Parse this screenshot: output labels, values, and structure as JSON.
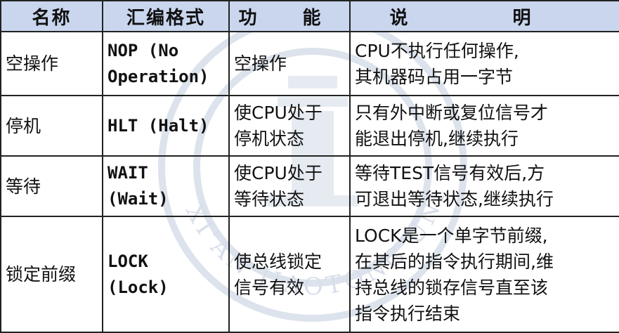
{
  "table": {
    "headers": [
      "名称",
      "汇编格式",
      "功 能",
      "说 明"
    ],
    "rows": [
      {
        "name": "空操作",
        "format_lines": [
          "NOP (No",
          "Operation)"
        ],
        "function_lines": [
          "空操作"
        ],
        "description_lines": [
          "CPU不执行任何操作,",
          "其机器码占用一字节"
        ]
      },
      {
        "name": "停机",
        "format_lines": [
          "HLT (Halt)"
        ],
        "function_lines": [
          "使CPU处于",
          "停机状态"
        ],
        "description_lines": [
          "只有外中断或复位信号才",
          "能退出停机,继续执行"
        ]
      },
      {
        "name": "等待",
        "format_lines": [
          "WAIT",
          "(Wait)"
        ],
        "function_lines": [
          "使CPU处于",
          "等待状态"
        ],
        "description_lines": [
          "等待TEST信号有效后,方",
          "可退出等待状态,继续执行"
        ]
      },
      {
        "name": "锁定前缀",
        "format_lines": [
          "LOCK",
          "(Lock)"
        ],
        "function_lines": [
          "使总线锁定",
          "信号有效"
        ],
        "description_lines": [
          "LOCK是一个单字节前缀,",
          "在其后的指令执行期间,维",
          "持总线的锁存信号直至该",
          "指令执行结束"
        ]
      }
    ]
  },
  "colors": {
    "header_bg": "#c9d6ee",
    "border": "#222222",
    "watermark": "#dde3ec"
  },
  "watermark": {
    "icon": "university-seal-icon",
    "text": "XI'AN JIAOTONG UNIVERSITY"
  }
}
